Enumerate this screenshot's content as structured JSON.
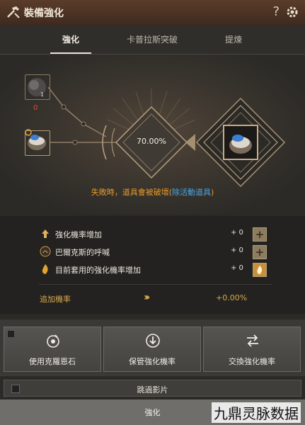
{
  "window": {
    "title": "裝備強化",
    "help": "?"
  },
  "tabs": [
    {
      "label": "強化"
    },
    {
      "label": "卡普拉斯突破"
    },
    {
      "label": "提煉"
    }
  ],
  "stage": {
    "stone_count": "1",
    "material_count": "0",
    "success_rate": "70.00%",
    "fail_warning": "失敗時，道具會被破壞(",
    "fail_link": "除活動道具",
    "fail_close": ")"
  },
  "stats": [
    {
      "label": "強化機率增加",
      "value": "+ 0",
      "button": "+"
    },
    {
      "label": "巴爾克斯的呼喊",
      "value": "+ 0",
      "button": "+"
    },
    {
      "label": "目前套用的強化機率增加",
      "value": "+ 0",
      "button": ""
    }
  ],
  "extra": {
    "label": "追加機率",
    "arrows": "›››",
    "value": "+0.00%"
  },
  "actions": [
    {
      "label": "使用克羅恩石"
    },
    {
      "label": "保管強化機率"
    },
    {
      "label": "交換強化機率"
    }
  ],
  "skip": {
    "label": "跳過影片"
  },
  "enhance": {
    "label": "強化"
  },
  "watermark": {
    "text": "九鼎灵脉数据"
  },
  "colors": {
    "accent": "#d7a84a",
    "warning": "#e79a2a",
    "link": "#4aa7e8",
    "error": "#e04a3b"
  }
}
